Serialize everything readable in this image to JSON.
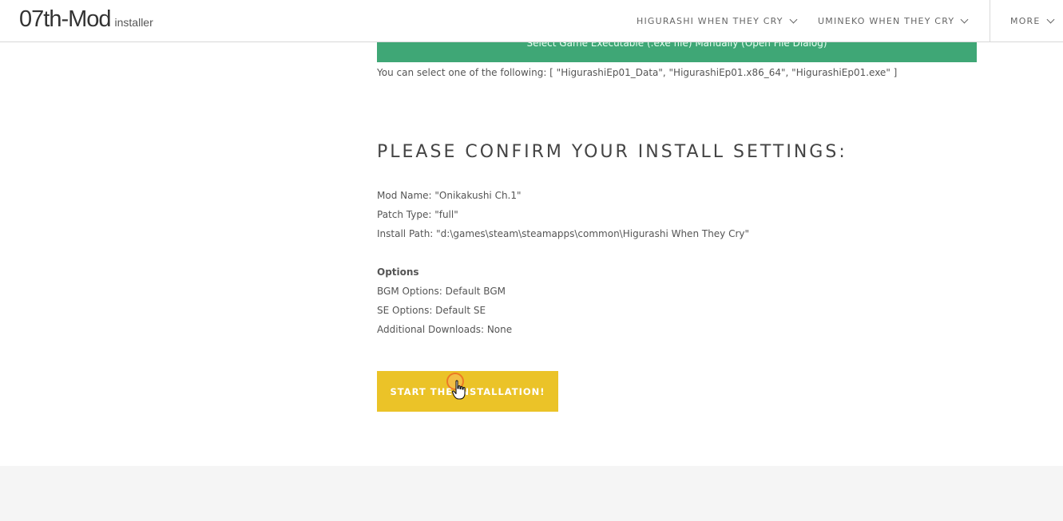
{
  "header": {
    "brand_main": "07th-Mod",
    "brand_sub": "installer",
    "nav": [
      {
        "label": "HIGURASHI WHEN THEY CRY"
      },
      {
        "label": "UMINEKO WHEN THEY CRY"
      },
      {
        "label": "MORE"
      }
    ]
  },
  "select_exe": {
    "button_label": "Select Game Executable (.exe file) Manually (Open File Dialog)",
    "hint": "You can select one of the following: [ \"HigurashiEp01_Data\", \"HigurashiEp01.x86_64\", \"HigurashiEp01.exe\" ]"
  },
  "confirm": {
    "title": "PLEASE CONFIRM YOUR INSTALL SETTINGS:",
    "mod_name": "Mod Name: \"Onikakushi Ch.1\"",
    "patch_type": "Patch Type: \"full\"",
    "install_path": "Install Path: \"d:\\games\\steam\\steamapps\\common\\Higurashi When They Cry\"",
    "options_heading": "Options",
    "bgm_options": "BGM Options: Default BGM",
    "se_options": "SE Options: Default SE",
    "additional_downloads": "Additional Downloads: None",
    "start_button": "START THE INSTALLATION!"
  },
  "colors": {
    "green_button": "#3fa776",
    "start_button": "#ebc328",
    "footer_bg": "#f5f5f5"
  },
  "icons": {
    "nav_dropdown": "chevron-down-icon",
    "cursor": "hand-pointer-icon"
  }
}
